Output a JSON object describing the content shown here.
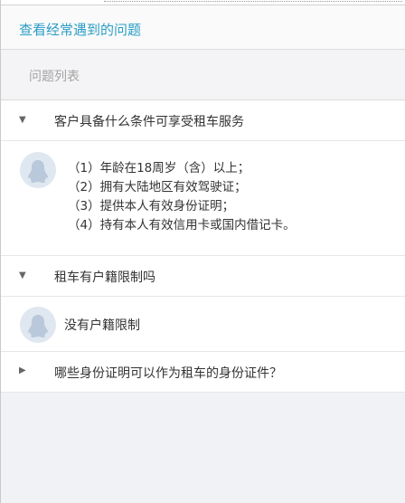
{
  "header": {
    "title": "查看经常遇到的问题"
  },
  "subheader": {
    "label": "问题列表"
  },
  "faq": [
    {
      "question": "客户具备什么条件可享受租车服务",
      "expanded": true,
      "answer_lines": [
        "（1）年龄在18周岁（含）以上；",
        "（2）拥有大陆地区有效驾驶证；",
        "（3）提供本人有效身份证明；",
        "（4）持有本人有效信用卡或国内借记卡。"
      ]
    },
    {
      "question": "租车有户籍限制吗",
      "expanded": true,
      "answer": "没有户籍限制"
    },
    {
      "question": "哪些身份证明可以作为租车的身份证件？",
      "expanded": false
    }
  ],
  "icons": {
    "expanded": "triangle-down",
    "collapsed": "triangle-right",
    "avatar": "penguin-avatar"
  },
  "colors": {
    "accent": "#2a9dc6",
    "page_bg": "#f1f2f6",
    "avatar_bg": "#dfe7f0",
    "avatar_fg": "#b9c8da"
  }
}
